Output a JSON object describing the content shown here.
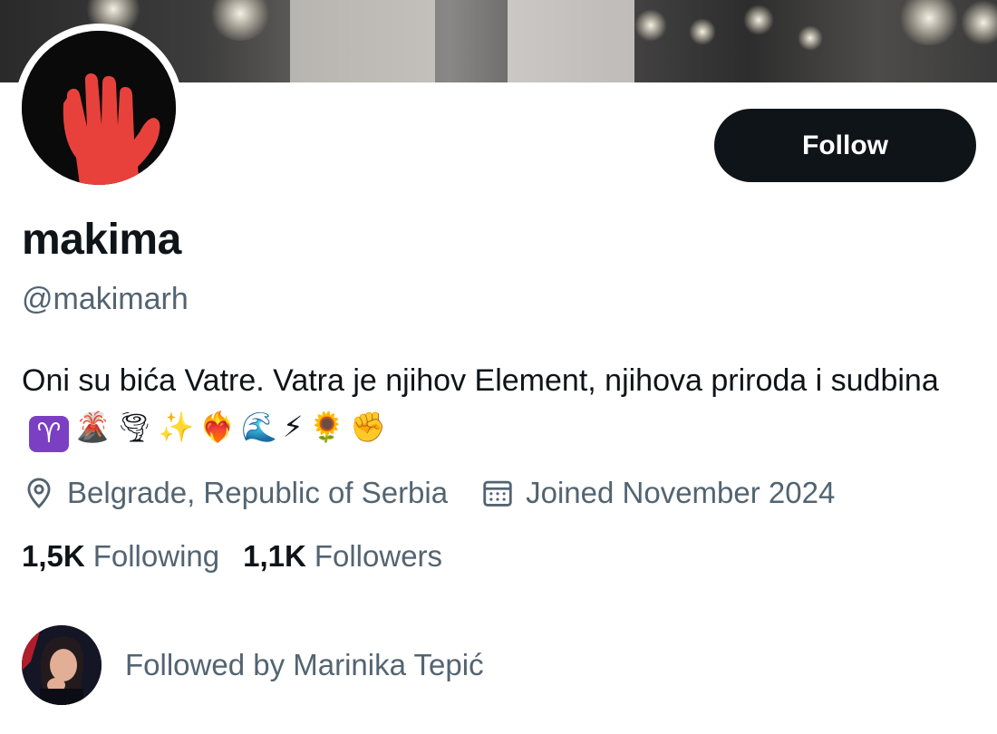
{
  "profile": {
    "name": "makima",
    "handle": "@makimarh",
    "follow_label": "Follow",
    "bio_text": "Oni su bića Vatre. Vatra je njihov Element, njihova priroda i sudbina",
    "bio_emojis": [
      "♈",
      "🌋",
      "🌪",
      "✨",
      "❤️‍🔥",
      "🌊",
      "⚡",
      "🌻",
      "✊"
    ],
    "location": "Belgrade, Republic of Serbia",
    "joined": "Joined November 2024",
    "following_count": "1,5K",
    "following_label": "Following",
    "followers_count": "1,1K",
    "followers_label": "Followers",
    "followed_by": "Followed by Marinika Tepić"
  },
  "colors": {
    "text_primary": "#0f1419",
    "text_secondary": "#536471",
    "button_bg": "#0f1419",
    "avatar_hand": "#e8413c"
  },
  "icons": {
    "location": "location-pin-icon",
    "calendar": "calendar-icon"
  }
}
